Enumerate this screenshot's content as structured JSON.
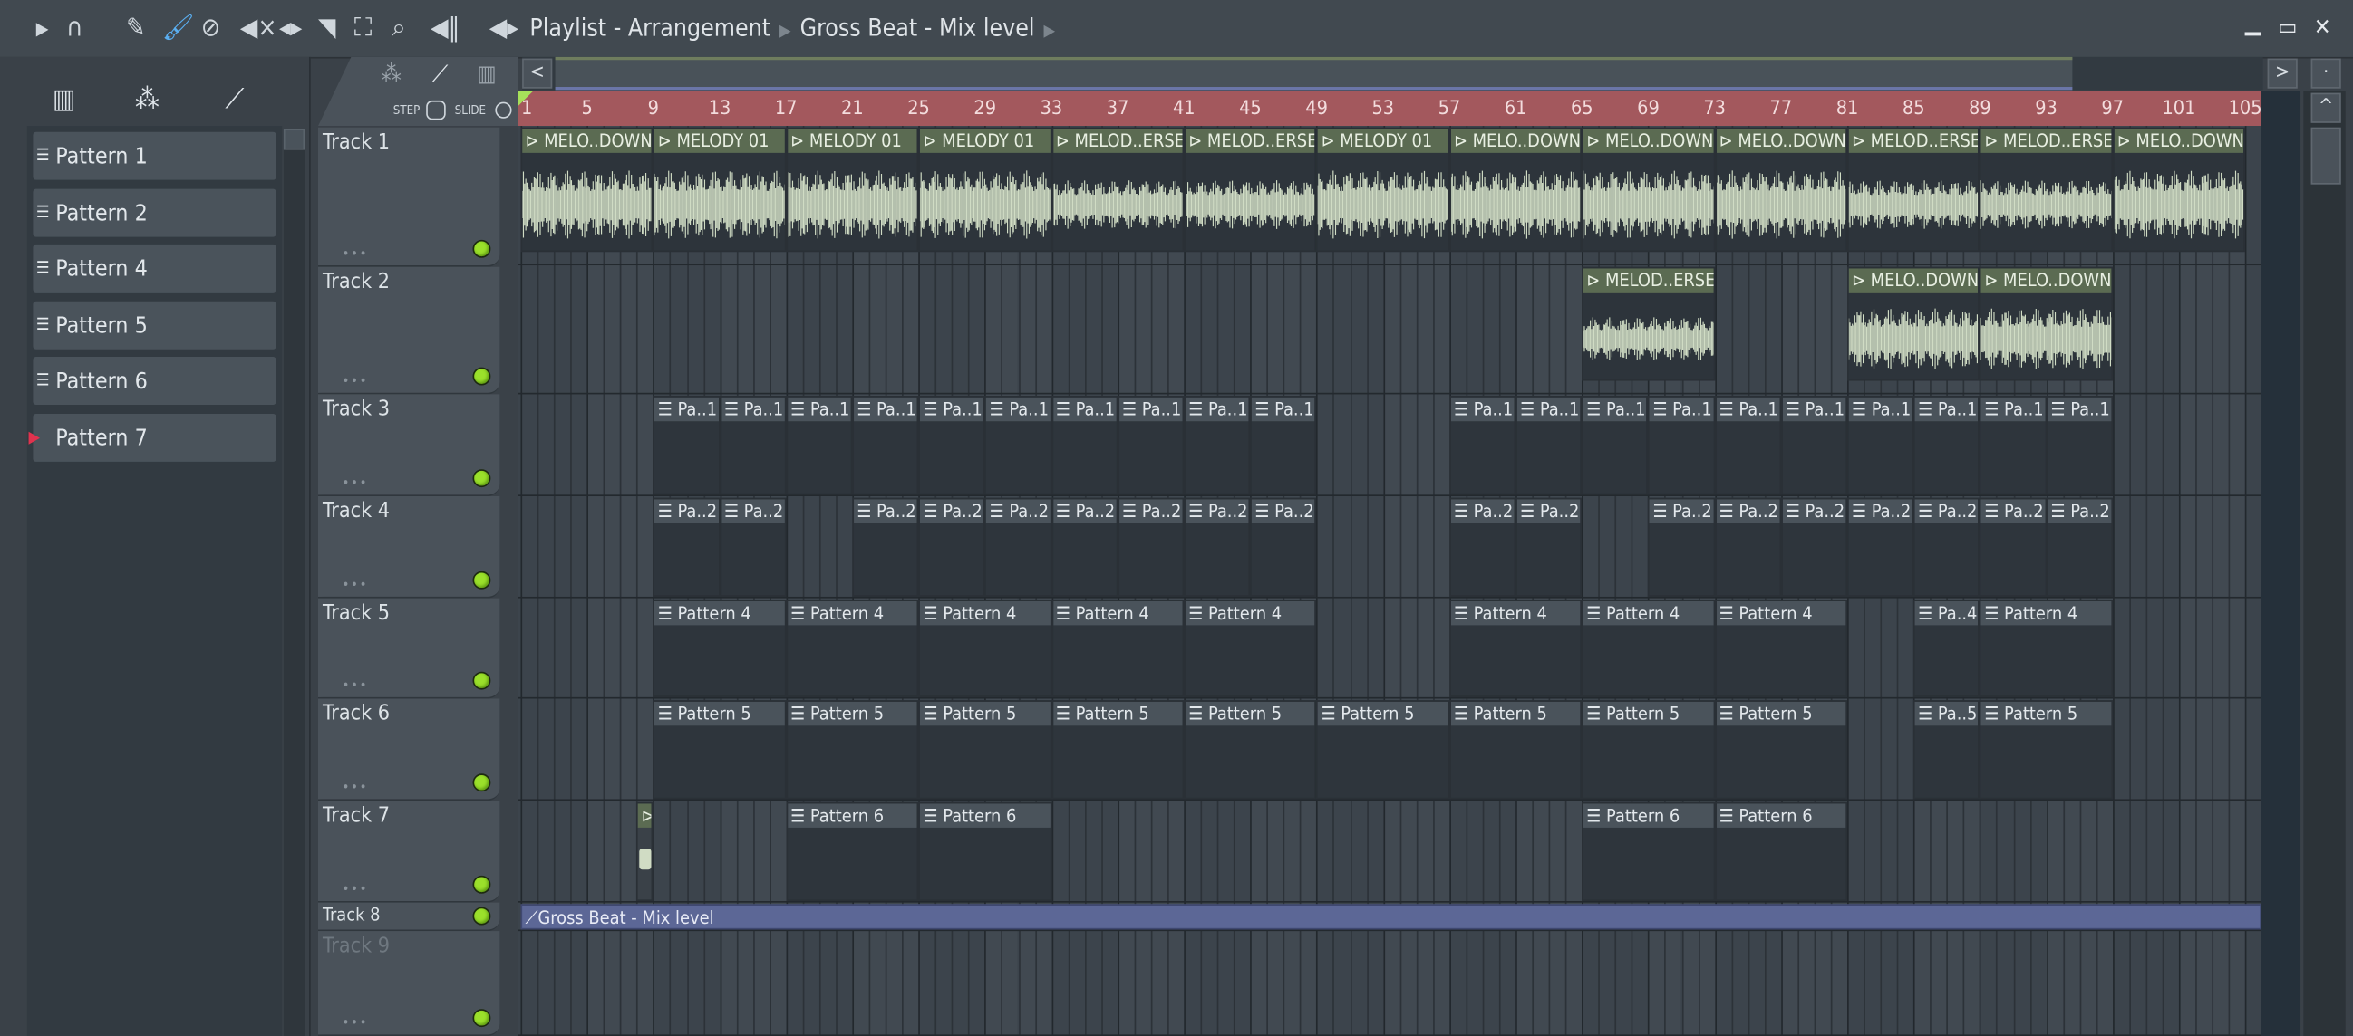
{
  "titlebar": {
    "icons": [
      "play-arrow-icon",
      "magnet-icon",
      "pencil-icon",
      "paint-brush-icon",
      "delete-icon",
      "mute-icon",
      "slip-icon",
      "slice-icon",
      "select-icon",
      "zoom-icon",
      "playback-icon",
      "speaker-icon"
    ],
    "title": "Playlist - Arrangement",
    "subtitle": "Gross Beat - Mix level"
  },
  "left_panel": {
    "patterns": [
      {
        "label": "Pattern 1"
      },
      {
        "label": "Pattern 2"
      },
      {
        "label": "Pattern 4"
      },
      {
        "label": "Pattern 5"
      },
      {
        "label": "Pattern 6"
      },
      {
        "label": "Pattern 7",
        "selected": true
      }
    ]
  },
  "track_header": {
    "step_label": "STEP",
    "slide_label": "SLIDE"
  },
  "ruler": {
    "ticks": [
      "1",
      "5",
      "9",
      "13",
      "17",
      "21",
      "25",
      "29",
      "33",
      "37",
      "41",
      "45",
      "49",
      "53",
      "57",
      "61",
      "65",
      "69",
      "73",
      "77",
      "81",
      "85",
      "89",
      "93",
      "97",
      "101",
      "105"
    ]
  },
  "colors": {
    "ruler": "#a3585d",
    "audio_clip": "#5b6b52",
    "pattern_clip": "#4a535b",
    "automation_clip": "#5c6796",
    "led": "#9be02b"
  },
  "tracks": [
    {
      "name": "Track 1",
      "clips": [
        {
          "type": "audio",
          "start": 1,
          "len": 8,
          "label": "MELO..DOWN"
        },
        {
          "type": "audio",
          "start": 9,
          "len": 8,
          "label": "MELODY 01"
        },
        {
          "type": "audio",
          "start": 17,
          "len": 8,
          "label": "MELODY 01"
        },
        {
          "type": "audio",
          "start": 25,
          "len": 8,
          "label": "MELODY 01"
        },
        {
          "type": "audio",
          "start": 33,
          "len": 8,
          "label": "MELOD..ERSE"
        },
        {
          "type": "audio",
          "start": 41,
          "len": 8,
          "label": "MELOD..ERSE"
        },
        {
          "type": "audio",
          "start": 49,
          "len": 8,
          "label": "MELODY 01"
        },
        {
          "type": "audio",
          "start": 57,
          "len": 8,
          "label": "MELO..DOWN"
        },
        {
          "type": "audio",
          "start": 65,
          "len": 8,
          "label": "MELO..DOWN"
        },
        {
          "type": "audio",
          "start": 73,
          "len": 8,
          "label": "MELO..DOWN"
        },
        {
          "type": "audio",
          "start": 81,
          "len": 8,
          "label": "MELOD..ERSE"
        },
        {
          "type": "audio",
          "start": 89,
          "len": 8,
          "label": "MELOD..ERSE"
        },
        {
          "type": "audio",
          "start": 97,
          "len": 8,
          "label": "MELO..DOWN"
        }
      ]
    },
    {
      "name": "Track 2",
      "clips": [
        {
          "type": "audio",
          "start": 65,
          "len": 8,
          "label": "MELOD..ERSE"
        },
        {
          "type": "audio",
          "start": 81,
          "len": 8,
          "label": "MELO..DOWN"
        },
        {
          "type": "audio",
          "start": 89,
          "len": 8,
          "label": "MELO..DOWN"
        }
      ]
    },
    {
      "name": "Track 3",
      "clips": [
        {
          "type": "pattern",
          "start": 9,
          "len": 4,
          "label": "Pa..1"
        },
        {
          "type": "pattern",
          "start": 13,
          "len": 4,
          "label": "Pa..1"
        },
        {
          "type": "pattern",
          "start": 17,
          "len": 4,
          "label": "Pa..1"
        },
        {
          "type": "pattern",
          "start": 21,
          "len": 4,
          "label": "Pa..1"
        },
        {
          "type": "pattern",
          "start": 25,
          "len": 4,
          "label": "Pa..1"
        },
        {
          "type": "pattern",
          "start": 29,
          "len": 4,
          "label": "Pa..1"
        },
        {
          "type": "pattern",
          "start": 33,
          "len": 4,
          "label": "Pa..1"
        },
        {
          "type": "pattern",
          "start": 37,
          "len": 4,
          "label": "Pa..1"
        },
        {
          "type": "pattern",
          "start": 41,
          "len": 4,
          "label": "Pa..1"
        },
        {
          "type": "pattern",
          "start": 45,
          "len": 4,
          "label": "Pa..1"
        },
        {
          "type": "pattern",
          "start": 57,
          "len": 4,
          "label": "Pa..1"
        },
        {
          "type": "pattern",
          "start": 61,
          "len": 4,
          "label": "Pa..1"
        },
        {
          "type": "pattern",
          "start": 65,
          "len": 4,
          "label": "Pa..1"
        },
        {
          "type": "pattern",
          "start": 69,
          "len": 4,
          "label": "Pa..1"
        },
        {
          "type": "pattern",
          "start": 73,
          "len": 4,
          "label": "Pa..1"
        },
        {
          "type": "pattern",
          "start": 77,
          "len": 4,
          "label": "Pa..1"
        },
        {
          "type": "pattern",
          "start": 81,
          "len": 4,
          "label": "Pa..1"
        },
        {
          "type": "pattern",
          "start": 85,
          "len": 4,
          "label": "Pa..1"
        },
        {
          "type": "pattern",
          "start": 89,
          "len": 4,
          "label": "Pa..1"
        },
        {
          "type": "pattern",
          "start": 93,
          "len": 4,
          "label": "Pa..1"
        }
      ]
    },
    {
      "name": "Track 4",
      "clips": [
        {
          "type": "pattern",
          "start": 9,
          "len": 4,
          "label": "Pa..2"
        },
        {
          "type": "pattern",
          "start": 13,
          "len": 4,
          "label": "Pa..2"
        },
        {
          "type": "pattern",
          "start": 21,
          "len": 4,
          "label": "Pa..2"
        },
        {
          "type": "pattern",
          "start": 25,
          "len": 4,
          "label": "Pa..2"
        },
        {
          "type": "pattern",
          "start": 29,
          "len": 4,
          "label": "Pa..2"
        },
        {
          "type": "pattern",
          "start": 33,
          "len": 4,
          "label": "Pa..2"
        },
        {
          "type": "pattern",
          "start": 37,
          "len": 4,
          "label": "Pa..2"
        },
        {
          "type": "pattern",
          "start": 41,
          "len": 4,
          "label": "Pa..2"
        },
        {
          "type": "pattern",
          "start": 45,
          "len": 4,
          "label": "Pa..2"
        },
        {
          "type": "pattern",
          "start": 57,
          "len": 4,
          "label": "Pa..2"
        },
        {
          "type": "pattern",
          "start": 61,
          "len": 4,
          "label": "Pa..2"
        },
        {
          "type": "pattern",
          "start": 69,
          "len": 4,
          "label": "Pa..2"
        },
        {
          "type": "pattern",
          "start": 73,
          "len": 4,
          "label": "Pa..2"
        },
        {
          "type": "pattern",
          "start": 77,
          "len": 4,
          "label": "Pa..2"
        },
        {
          "type": "pattern",
          "start": 81,
          "len": 4,
          "label": "Pa..2"
        },
        {
          "type": "pattern",
          "start": 85,
          "len": 4,
          "label": "Pa..2"
        },
        {
          "type": "pattern",
          "start": 89,
          "len": 4,
          "label": "Pa..2"
        },
        {
          "type": "pattern",
          "start": 93,
          "len": 4,
          "label": "Pa..2"
        }
      ]
    },
    {
      "name": "Track 5",
      "clips": [
        {
          "type": "pattern",
          "start": 9,
          "len": 8,
          "label": "Pattern 4"
        },
        {
          "type": "pattern",
          "start": 17,
          "len": 8,
          "label": "Pattern 4"
        },
        {
          "type": "pattern",
          "start": 25,
          "len": 8,
          "label": "Pattern 4"
        },
        {
          "type": "pattern",
          "start": 33,
          "len": 8,
          "label": "Pattern 4"
        },
        {
          "type": "pattern",
          "start": 41,
          "len": 8,
          "label": "Pattern 4"
        },
        {
          "type": "pattern",
          "start": 57,
          "len": 8,
          "label": "Pattern 4"
        },
        {
          "type": "pattern",
          "start": 65,
          "len": 8,
          "label": "Pattern 4"
        },
        {
          "type": "pattern",
          "start": 73,
          "len": 8,
          "label": "Pattern 4"
        },
        {
          "type": "pattern",
          "start": 85,
          "len": 4,
          "label": "Pa..4"
        },
        {
          "type": "pattern",
          "start": 89,
          "len": 8,
          "label": "Pattern 4"
        }
      ]
    },
    {
      "name": "Track 6",
      "clips": [
        {
          "type": "pattern",
          "start": 9,
          "len": 8,
          "label": "Pattern 5"
        },
        {
          "type": "pattern",
          "start": 17,
          "len": 8,
          "label": "Pattern 5"
        },
        {
          "type": "pattern",
          "start": 25,
          "len": 8,
          "label": "Pattern 5"
        },
        {
          "type": "pattern",
          "start": 33,
          "len": 8,
          "label": "Pattern 5"
        },
        {
          "type": "pattern",
          "start": 41,
          "len": 8,
          "label": "Pattern 5"
        },
        {
          "type": "pattern",
          "start": 49,
          "len": 8,
          "label": "Pattern 5"
        },
        {
          "type": "pattern",
          "start": 57,
          "len": 8,
          "label": "Pattern 5"
        },
        {
          "type": "pattern",
          "start": 65,
          "len": 8,
          "label": "Pattern 5"
        },
        {
          "type": "pattern",
          "start": 73,
          "len": 8,
          "label": "Pattern 5"
        },
        {
          "type": "pattern",
          "start": 85,
          "len": 4,
          "label": "Pa..5"
        },
        {
          "type": "pattern",
          "start": 89,
          "len": 8,
          "label": "Pattern 5"
        }
      ]
    },
    {
      "name": "Track 7",
      "clips": [
        {
          "type": "audio",
          "start": 8,
          "len": 1,
          "label": ""
        },
        {
          "type": "pattern",
          "start": 17,
          "len": 8,
          "label": "Pattern 6"
        },
        {
          "type": "pattern",
          "start": 25,
          "len": 8,
          "label": "Pattern 6"
        },
        {
          "type": "pattern",
          "start": 65,
          "len": 8,
          "label": "Pattern 6"
        },
        {
          "type": "pattern",
          "start": 73,
          "len": 8,
          "label": "Pattern 6"
        }
      ]
    },
    {
      "name": "Track 8",
      "clips": [
        {
          "type": "automation",
          "start": 1,
          "len": 105,
          "label": "Gross Beat - Mix level"
        }
      ]
    },
    {
      "name": "Track 9",
      "clips": []
    }
  ]
}
